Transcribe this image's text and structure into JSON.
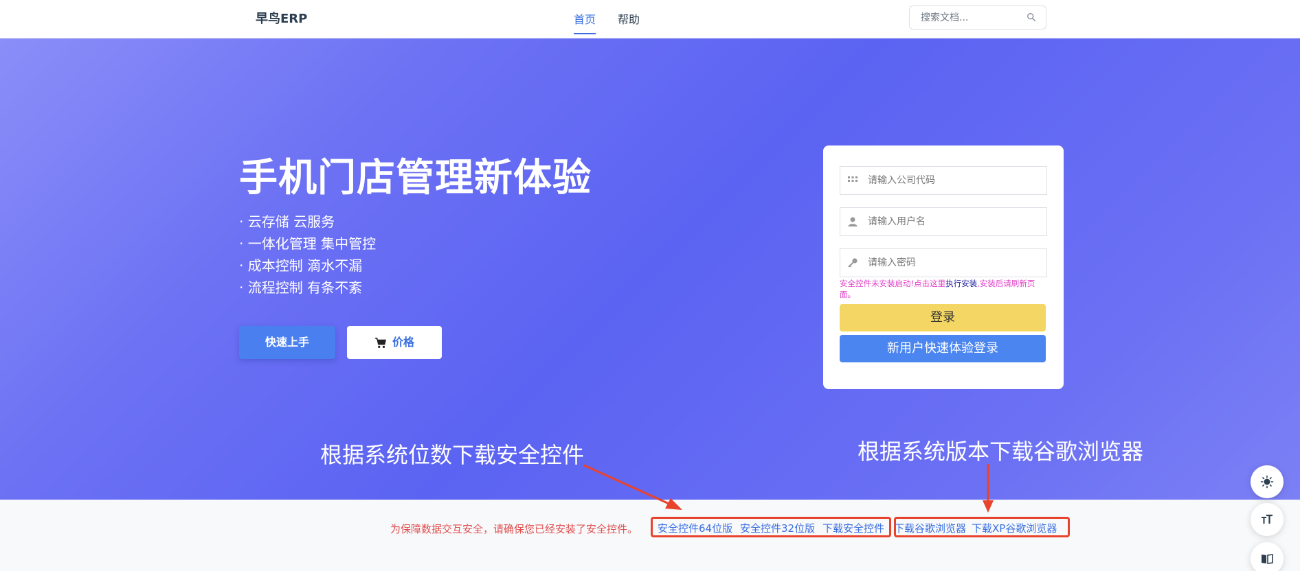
{
  "nav": {
    "brand": "早鸟ERP",
    "links": [
      {
        "label": "首页",
        "active": true
      },
      {
        "label": "帮助",
        "active": false
      }
    ],
    "search_placeholder": "搜索文档..."
  },
  "hero": {
    "title": "手机门店管理新体验",
    "features": [
      "· 云存储 云服务",
      "· 一体化管理 集中管控",
      "· 成本控制 滴水不漏",
      "· 流程控制 有条不紊"
    ],
    "quick_start_label": "快速上手",
    "price_label": "价格"
  },
  "login": {
    "company_placeholder": "请输入公司代码",
    "username_placeholder": "请输入用户名",
    "password_placeholder": "请输入密码",
    "notice_prefix": "安全控件未安装启动!点击这里",
    "notice_link": "执行安装",
    "notice_suffix": ",安装后请刷新页面。",
    "login_label": "登录",
    "trial_label": "新用户快速体验登录"
  },
  "annotations": {
    "left": "根据系统位数下载安全控件",
    "right": "根据系统版本下载谷歌浏览器"
  },
  "footer_bar": {
    "message": "为保障数据交互安全，请确保您已经安装了安全控件。",
    "links": [
      "安全控件64位版",
      "安全控件32位版",
      "下载安全控件",
      "下载谷歌浏览器",
      "下载XP谷歌浏览器"
    ]
  },
  "colors": {
    "accent": "#3a6fe0",
    "login_button": "#f3d663",
    "trial_button": "#4a85f0",
    "annotation_box": "#e8432c",
    "notice_text": "#e040c8"
  },
  "side_buttons": [
    "theme-toggle-icon",
    "font-size-icon",
    "read-mode-icon"
  ]
}
